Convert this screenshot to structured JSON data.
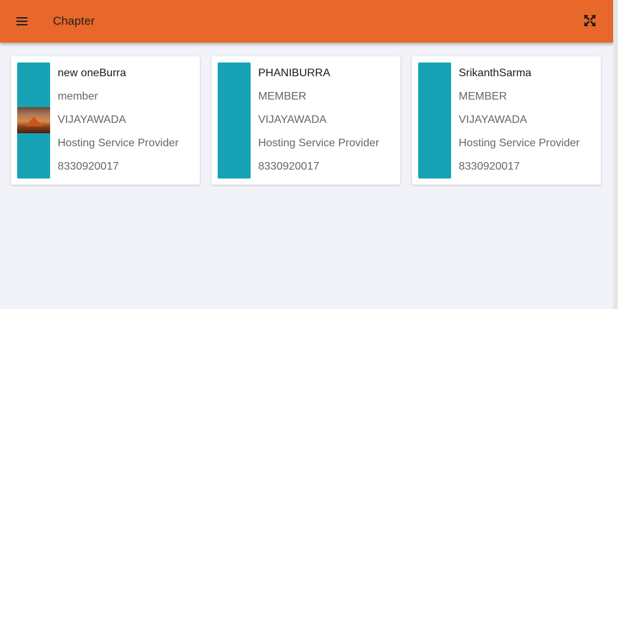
{
  "header": {
    "title": "Chapter",
    "menu_icon": "hamburger-menu-icon",
    "fullscreen_icon": "fullscreen-icon",
    "background_color": "#e8672a"
  },
  "members": [
    {
      "name": "new oneBurra",
      "role": "member",
      "city": "VIJAYAWADA",
      "business": "Hosting Service Provider",
      "phone": "8330920017",
      "has_photo": true
    },
    {
      "name": "PHANIBURRA",
      "role": "MEMBER",
      "city": "VIJAYAWADA",
      "business": "Hosting Service Provider",
      "phone": "8330920017",
      "has_photo": false
    },
    {
      "name": "SrikanthSarma",
      "role": "MEMBER",
      "city": "VIJAYAWADA",
      "business": "Hosting Service Provider",
      "phone": "8330920017",
      "has_photo": false
    }
  ],
  "colors": {
    "accent": "#16a3b6",
    "page_background": "#f2f3f8"
  }
}
